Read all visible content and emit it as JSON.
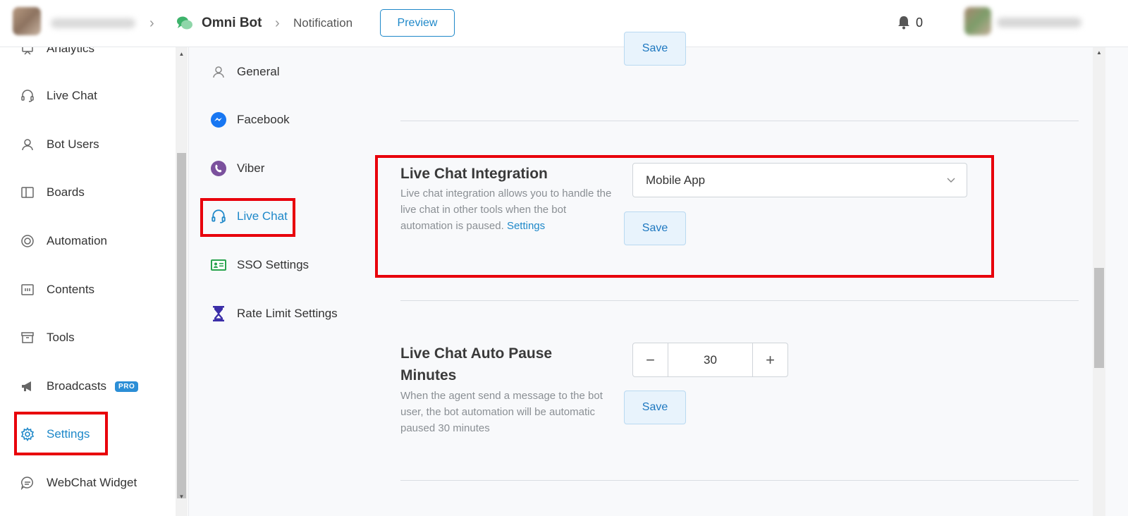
{
  "topbar": {
    "bot_name": "Omni Bot",
    "current_page": "Notification",
    "preview_label": "Preview",
    "notification_count": "0"
  },
  "sidebar": {
    "items": [
      {
        "label": "Analytics",
        "icon": "analytics-icon"
      },
      {
        "label": "Live Chat",
        "icon": "headset-icon"
      },
      {
        "label": "Bot Users",
        "icon": "user-icon"
      },
      {
        "label": "Boards",
        "icon": "board-icon"
      },
      {
        "label": "Automation",
        "icon": "lifebuoy-icon"
      },
      {
        "label": "Contents",
        "icon": "contents-icon"
      },
      {
        "label": "Tools",
        "icon": "archive-icon"
      },
      {
        "label": "Broadcasts",
        "icon": "megaphone-icon",
        "badge": "PRO"
      },
      {
        "label": "Settings",
        "icon": "gear-icon",
        "active": true
      },
      {
        "label": "WebChat Widget",
        "icon": "chat-bubble-icon"
      }
    ]
  },
  "settings_nav": {
    "items": [
      {
        "label": "General",
        "icon": "user-icon"
      },
      {
        "label": "Facebook",
        "icon": "messenger-icon"
      },
      {
        "label": "Viber",
        "icon": "viber-icon"
      },
      {
        "label": "Live Chat",
        "icon": "headset-icon",
        "active": true
      },
      {
        "label": "SSO Settings",
        "icon": "id-card-icon"
      },
      {
        "label": "Rate Limit Settings",
        "icon": "hourglass-icon"
      }
    ]
  },
  "content": {
    "top_save_label": "Save",
    "live_chat_integration": {
      "title": "Live Chat Integration",
      "description": "Live chat integration allows you to handle the live chat in other tools when the bot automation is paused.",
      "settings_link": "Settings",
      "selected_option": "Mobile App",
      "save_label": "Save"
    },
    "auto_pause": {
      "title": "Live Chat Auto Pause Minutes",
      "description": "When the agent send a message to the bot user, the bot automation will be automatic paused 30 minutes",
      "value": "30",
      "minus_label": "−",
      "plus_label": "+",
      "save_label": "Save"
    }
  },
  "colors": {
    "accent": "#1e88c9",
    "highlight": "#e8000b",
    "save_bg": "#e8f3fc"
  }
}
